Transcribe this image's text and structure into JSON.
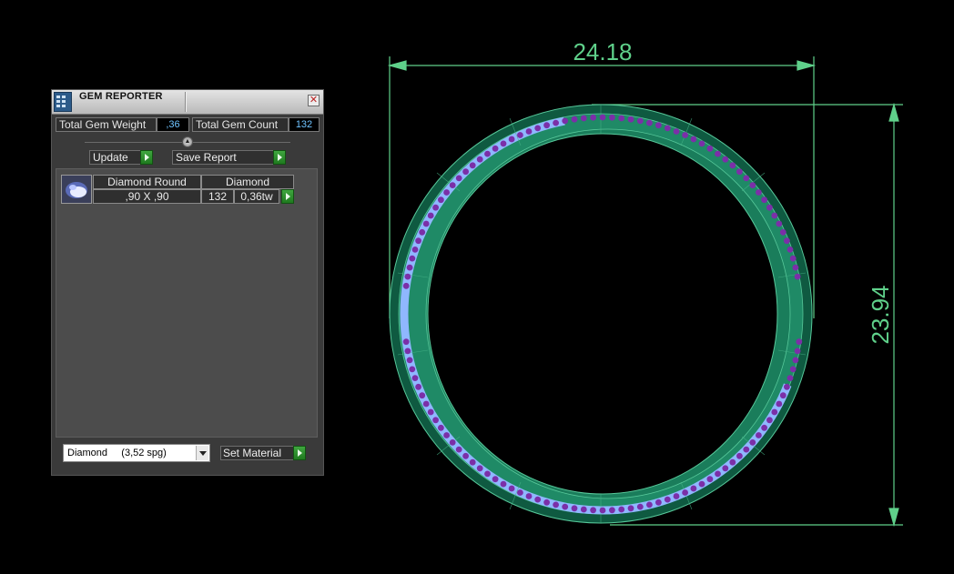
{
  "panel": {
    "title": "GEM REPORTER",
    "close_label": "✕",
    "total_weight_label": "Total Gem Weight",
    "total_weight_value": ",36",
    "total_count_label": "Total Gem Count",
    "total_count_value": "132",
    "update_label": "Update",
    "save_report_label": "Save Report",
    "gem": {
      "shape": "Diamond Round",
      "material": "Diamond",
      "size": ",90 X ,90",
      "count": "132",
      "weight": "0,36tw"
    },
    "material_select_value": "Diamond     (3,52 spg)",
    "set_material_label": "Set Material"
  },
  "viewport": {
    "width_dimension": "24.18",
    "height_dimension": "23.94",
    "colors": {
      "dimension": "#5fd08a",
      "band": "#1f8a66",
      "band_highlight": "#57c89a",
      "channel": "#8fb7ff",
      "gem": "#7b2fa8"
    }
  }
}
